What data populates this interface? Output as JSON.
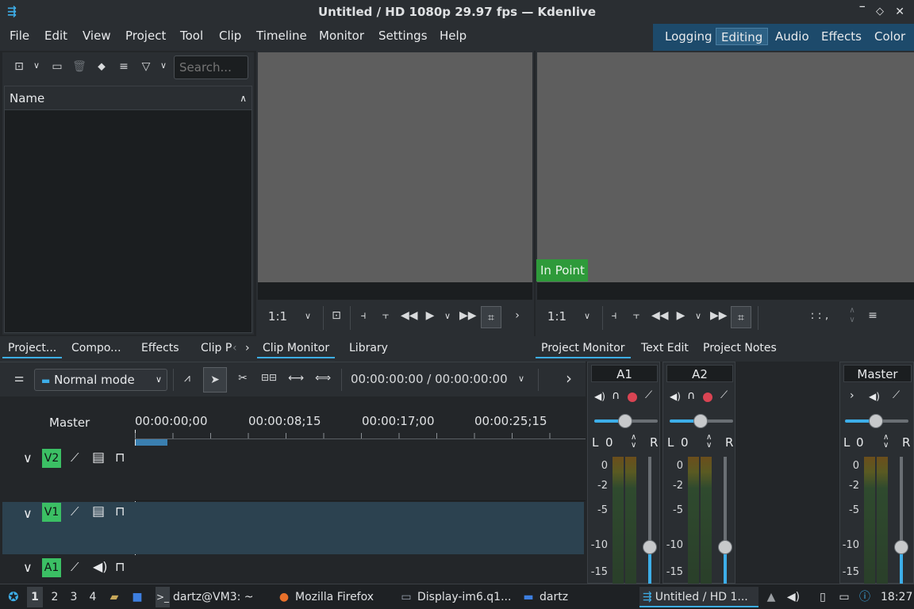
{
  "window": {
    "title": "Untitled / HD 1080p 29.97 fps — Kdenlive"
  },
  "menu": [
    "File",
    "Edit",
    "View",
    "Project",
    "Tool",
    "Clip",
    "Timeline",
    "Monitor",
    "Settings",
    "Help"
  ],
  "layouts": {
    "items": [
      "Logging",
      "Editing",
      "Audio",
      "Effects",
      "Color"
    ],
    "active": "Editing"
  },
  "project_bin": {
    "search_placeholder": "Search...",
    "column_name": "Name"
  },
  "left_tabs": [
    "Project...",
    "Compo...",
    "Effects",
    "Clip P"
  ],
  "clip_monitor": {
    "zoom": "1:1",
    "tabs": [
      "Clip Monitor",
      "Library"
    ],
    "active_tab": "Clip Monitor"
  },
  "project_monitor": {
    "zoom": "1:1",
    "in_point_label": "In Point",
    "timecode": ": : ,",
    "tabs": [
      "Project Monitor",
      "Text Edit",
      "Project Notes"
    ],
    "active_tab": "Project Monitor"
  },
  "timeline": {
    "mode": "Normal mode",
    "timecode": "00:00:00:00 / 00:00:00:00",
    "master_label": "Master",
    "ruler": [
      "00:00:00;00",
      "00:00:08;15",
      "00:00:17;00",
      "00:00:25;15"
    ],
    "tracks": [
      {
        "name": "V2",
        "type": "video"
      },
      {
        "name": "V1",
        "type": "video"
      },
      {
        "name": "A1",
        "type": "audio"
      }
    ]
  },
  "mixer": {
    "channels": [
      {
        "name": "A1",
        "pan_l": "L",
        "pan_value": "0",
        "pan_r": "R"
      },
      {
        "name": "A2",
        "pan_l": "L",
        "pan_value": "0",
        "pan_r": "R"
      },
      {
        "name": "Master",
        "pan_l": "L",
        "pan_value": "0",
        "pan_r": "R"
      }
    ],
    "scale": [
      "0",
      "-2",
      "-5",
      "-10",
      "-15"
    ]
  },
  "taskbar": {
    "workspaces": [
      "1",
      "2",
      "3",
      "4"
    ],
    "active_workspace": "1",
    "apps": [
      "dartz@VM3: ~",
      "Mozilla Firefox",
      "Display-im6.q1...",
      "dartz",
      "Untitled / HD 1..."
    ],
    "clock": "18:27"
  },
  "colors": {
    "accent": "#3daee9",
    "track_badge": "#3bbf64",
    "in_point": "#2e9a3a",
    "layout_bar": "#1d4a6b"
  }
}
